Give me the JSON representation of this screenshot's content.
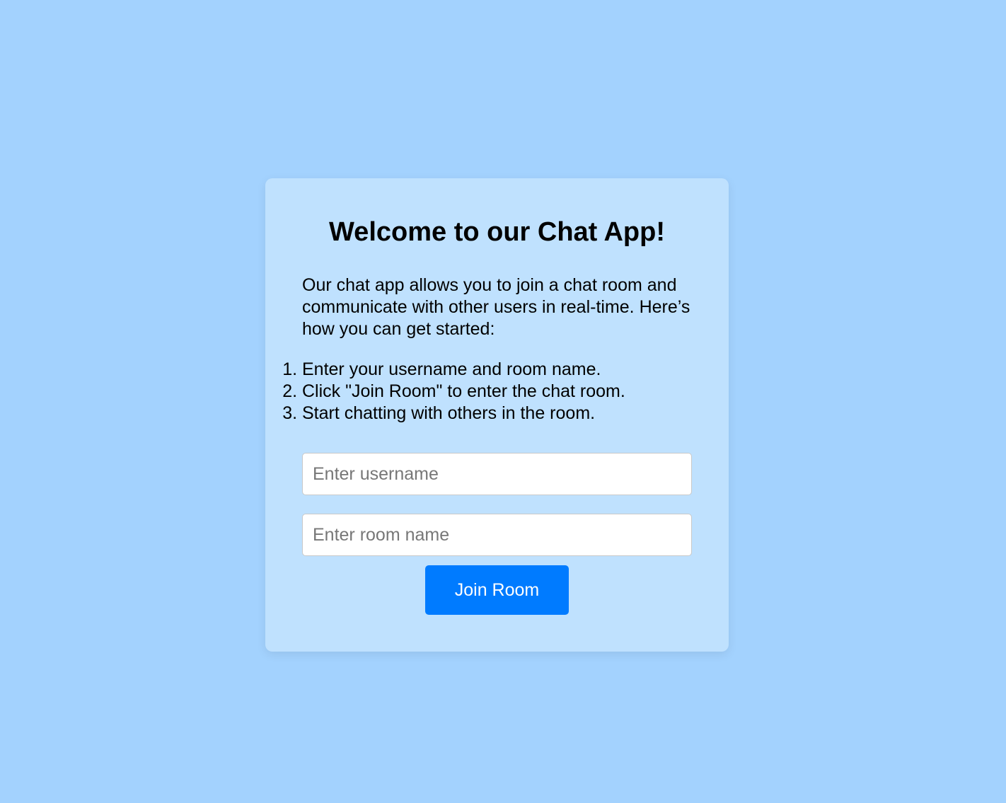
{
  "welcome": {
    "title": "Welcome to our Chat App!",
    "intro": "Our chat app allows you to join a chat room and communicate with other users in real-time. Here’s how you can get started:",
    "steps": [
      "Enter your username and room name.",
      "Click \"Join Room\" to enter the chat room.",
      "Start chatting with others in the room."
    ]
  },
  "form": {
    "username_placeholder": "Enter username",
    "username_value": "",
    "room_placeholder": "Enter room name",
    "room_value": "",
    "join_label": "Join Room"
  },
  "colors": {
    "page_background": "#a3d2fe",
    "card_background": "#bfe1fe",
    "accent": "#007bff"
  }
}
